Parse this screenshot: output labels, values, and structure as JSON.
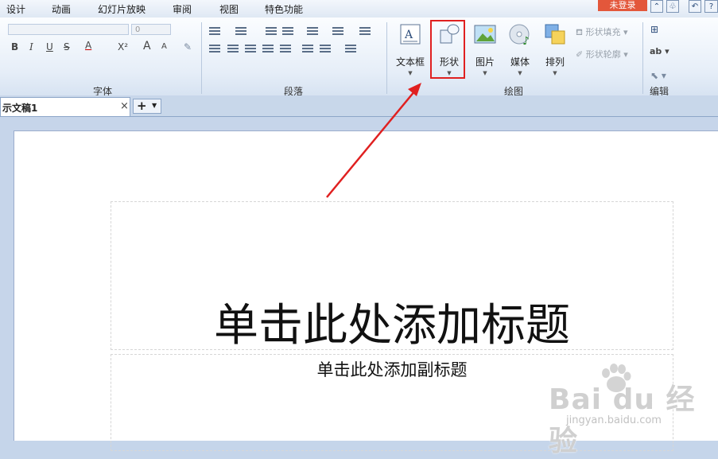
{
  "menu": {
    "items": [
      "设计",
      "动画",
      "幻灯片放映",
      "审阅",
      "视图",
      "特色功能"
    ],
    "login": "未登录"
  },
  "ribbon": {
    "font_size_value": "0",
    "font_buttons": [
      "B",
      "I",
      "U",
      "S",
      "A",
      "X²",
      "A",
      "A"
    ],
    "groups": {
      "font": "字体",
      "paragraph": "段落",
      "drawing": "绘图",
      "edit": "编辑"
    },
    "big_buttons": [
      {
        "label": "文本框",
        "icon": "textbox-icon"
      },
      {
        "label": "形状",
        "icon": "shapes-icon"
      },
      {
        "label": "图片",
        "icon": "picture-icon"
      },
      {
        "label": "媒体",
        "icon": "media-icon"
      },
      {
        "label": "排列",
        "icon": "arrange-icon"
      }
    ],
    "shape_fill": "形状填充",
    "shape_outline": "形状轮廓",
    "edit_ab": "ab"
  },
  "tabs": {
    "document": "示文稿1",
    "close": "×",
    "add": "+"
  },
  "slide": {
    "title_placeholder": "单击此处添加标题",
    "subtitle_placeholder": "单击此处添加副标题"
  },
  "watermark": {
    "brand": "Bai du 经验",
    "url": "jingyan.baidu.com"
  },
  "colors": {
    "highlight": "#e02020",
    "login_bg": "#e3573b",
    "accent": "#2c4c7a"
  }
}
